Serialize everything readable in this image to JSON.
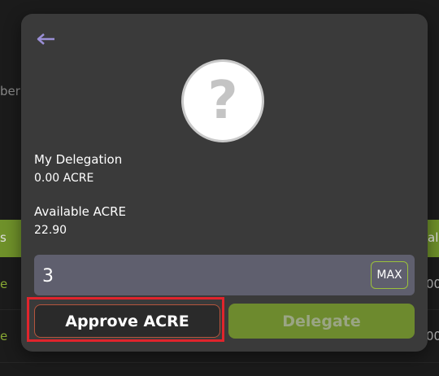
{
  "background": {
    "left_partial_text": "ber",
    "header_left_partial": "s",
    "header_right_partial": "al",
    "rows": [
      {
        "left": "e",
        "right": "00"
      },
      {
        "left": "e",
        "right": "00"
      }
    ]
  },
  "modal": {
    "back_icon": "arrow-left-icon",
    "avatar_icon": "question-mark-icon",
    "avatar_glyph": "?",
    "my_delegation": {
      "label": "My Delegation",
      "value": "0.00 ACRE"
    },
    "available": {
      "label": "Available ACRE",
      "value": "22.90"
    },
    "amount_input": {
      "value": "3"
    },
    "max_label": "MAX",
    "approve_label": "Approve ACRE",
    "delegate_label": "Delegate"
  },
  "colors": {
    "modal_bg": "#3a3a3a",
    "accent_green": "#7fa530",
    "delegate_disabled": "#6d8a2e",
    "approve_border": "#b5553d",
    "highlight_red": "#e0242c"
  }
}
